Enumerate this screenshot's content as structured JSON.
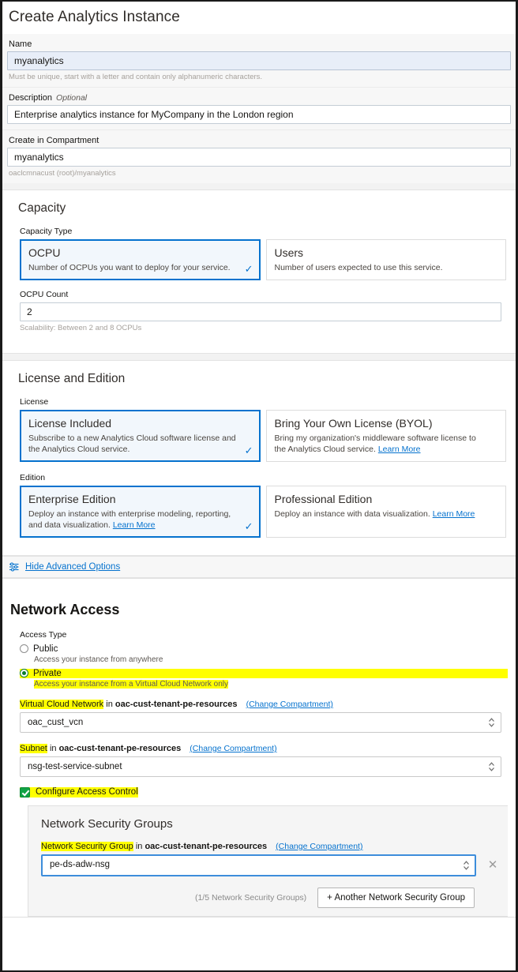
{
  "page": {
    "title": "Create Analytics Instance"
  },
  "basics": {
    "name_label": "Name",
    "name_value": "myanalytics",
    "name_help": "Must be unique, start with a letter and contain only alphanumeric characters.",
    "description_label": "Description",
    "description_optional": "Optional",
    "description_value": "Enterprise analytics instance for MyCompany in the London region",
    "compartment_label": "Create in Compartment",
    "compartment_value": "myanalytics",
    "compartment_path": "oaclcmnacust (root)/myanalytics"
  },
  "capacity": {
    "heading": "Capacity",
    "type_label": "Capacity Type",
    "tiles": [
      {
        "title": "OCPU",
        "desc": "Number of OCPUs you want to deploy for your service.",
        "selected": true,
        "check": "✓"
      },
      {
        "title": "Users",
        "desc": "Number of users expected to use this service.",
        "selected": false,
        "check": ""
      }
    ],
    "ocpu_count_label": "OCPU Count",
    "ocpu_count_value": "2",
    "ocpu_help": "Scalability: Between 2 and 8 OCPUs"
  },
  "license": {
    "heading": "License and Edition",
    "license_label": "License",
    "license_tiles": [
      {
        "title": "License Included",
        "desc": "Subscribe to a new Analytics Cloud software license and the Analytics Cloud service.",
        "link": "",
        "selected": true,
        "check": "✓"
      },
      {
        "title": "Bring Your Own License (BYOL)",
        "desc": "Bring my organization's middleware software license to the Analytics Cloud service.",
        "link": "Learn More",
        "selected": false,
        "check": ""
      }
    ],
    "edition_label": "Edition",
    "edition_tiles": [
      {
        "title": "Enterprise Edition",
        "desc": "Deploy an instance with enterprise modeling, reporting, and data visualization.",
        "link": "Learn More",
        "selected": true,
        "check": "✓"
      },
      {
        "title": "Professional Edition",
        "desc": "Deploy an instance with data visualization.",
        "link": "Learn More",
        "selected": false,
        "check": ""
      }
    ]
  },
  "advanced": {
    "toggle_label": "Hide Advanced Options"
  },
  "network": {
    "heading": "Network Access",
    "access_type_label": "Access Type",
    "public_label": "Public",
    "public_sub": "Access your instance from anywhere",
    "private_label": "Private",
    "private_sub": "Access your instance from a Virtual Cloud Network only",
    "vcn_label": "Virtual Cloud Network",
    "vcn_in": "in",
    "vcn_compartment": "oac-cust-tenant-pe-resources",
    "vcn_change": "(Change Compartment)",
    "vcn_value": "oac_cust_vcn",
    "subnet_label": "Subnet",
    "subnet_in": "in",
    "subnet_compartment": "oac-cust-tenant-pe-resources",
    "subnet_change": "(Change Compartment)",
    "subnet_value": "nsg-test-service-subnet",
    "access_control_label": "Configure Access Control"
  },
  "nsg": {
    "heading": "Network Security Groups",
    "label": "Network Security Group",
    "in": "in",
    "compartment": "oac-cust-tenant-pe-resources",
    "change": "(Change Compartment)",
    "value": "pe-ds-adw-nsg",
    "remove_icon": "✕",
    "count_text": "(1/5 Network Security Groups)",
    "add_label": "+ Another Network Security Group"
  },
  "colors": {
    "accent_blue": "#0572ce",
    "highlight_yellow": "#ffff00",
    "check_green": "#11a345",
    "radio_green": "#0a7c2f"
  }
}
